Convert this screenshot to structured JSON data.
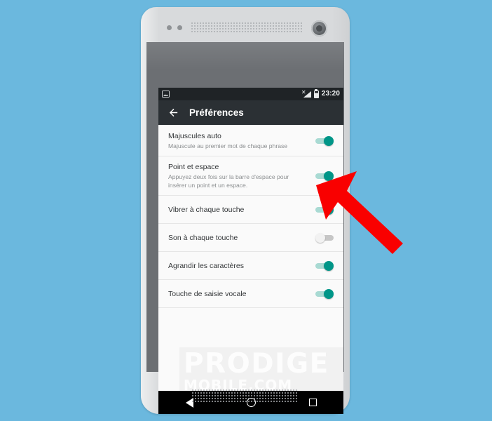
{
  "page": {
    "background_color": "#6bb8de",
    "device_body_color": "#d8dadc",
    "bezel_color": "#6c6f73"
  },
  "status_bar": {
    "clock": "23:20",
    "left_icons": [
      "screenshot-icon"
    ],
    "right_icons": [
      "signal-icon",
      "battery-icon"
    ],
    "background_color": "#1f2326"
  },
  "app_bar": {
    "back_icon": "back-arrow-icon",
    "title": "Préférences",
    "background_color": "#2b3034"
  },
  "settings": {
    "accent_on_color": "#009688",
    "track_on_color": "#a9dad3",
    "track_off_color": "#c6c6c6",
    "thumb_off_color": "#f2f2f2",
    "items": [
      {
        "title": "Majuscules auto",
        "summary": "Majuscule au premier mot de chaque phrase",
        "state": "on",
        "state_label": "Activé"
      },
      {
        "title": "Point et espace",
        "summary": "Appuyez deux fois sur la barre d'espace pour insérer un point et un espace.",
        "state": "on",
        "state_label": "Activé"
      },
      {
        "title": "Vibrer à chaque touche",
        "summary": "",
        "state": "on",
        "state_label": "Activé"
      },
      {
        "title": "Son à chaque touche",
        "summary": "",
        "state": "off",
        "state_label": "Désactivé"
      },
      {
        "title": "Agrandir les caractères",
        "summary": "",
        "state": "on",
        "state_label": "Activé"
      },
      {
        "title": "Touche de saisie vocale",
        "summary": "",
        "state": "on",
        "state_label": "Activé"
      }
    ]
  },
  "watermark": {
    "main": "PRODIGE",
    "sub": "MOBILE.COM"
  },
  "nav_bar": {
    "back": "nav-back-icon",
    "home": "nav-home-icon",
    "recents": "nav-recents-icon",
    "background_color": "#000000"
  },
  "annotation": {
    "arrow_color": "#f90000",
    "points_to": "Vibrer à chaque touche"
  }
}
